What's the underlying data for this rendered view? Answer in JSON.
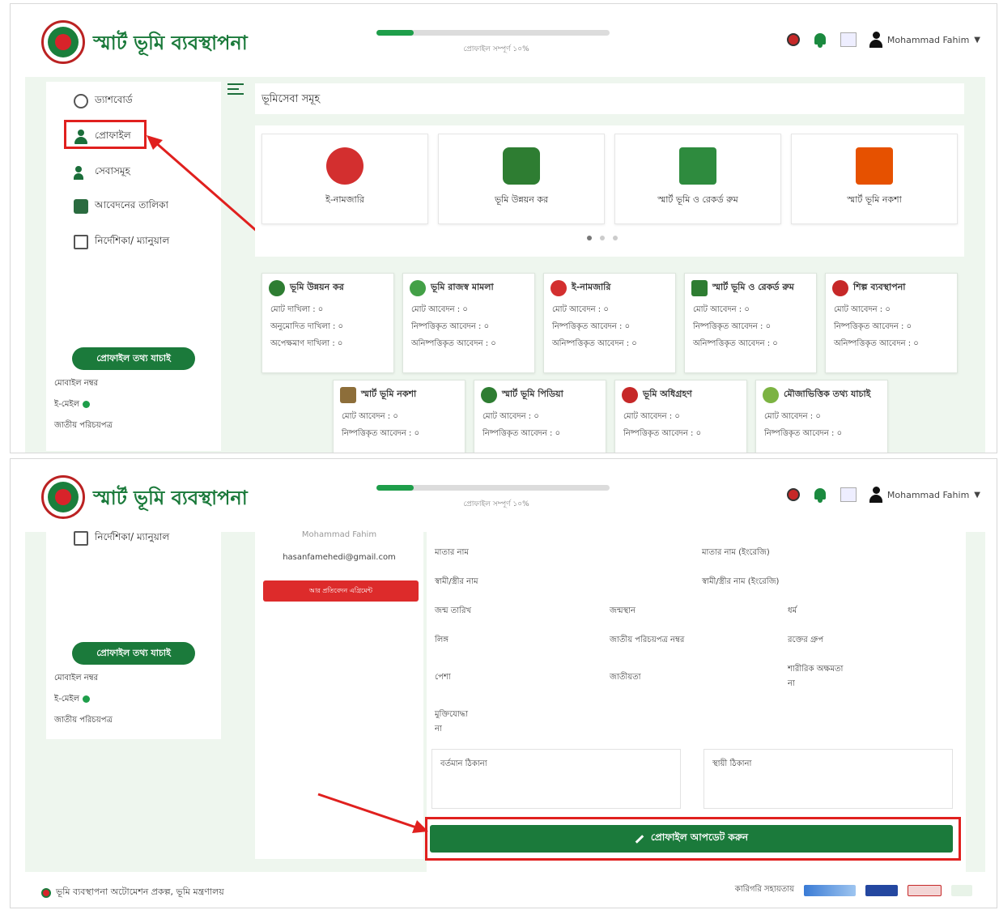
{
  "header": {
    "app_title": "স্মার্ট ভূমি ব্যবস্থাপনা",
    "progress_label": "প্রোফাইল সম্পূর্ণ ১০%",
    "progress_percent": 10,
    "user_name": "Mohammad Fahim"
  },
  "sidebar": {
    "items": [
      {
        "label": "ড্যাশবোর্ড",
        "icon": "dashboard-icon"
      },
      {
        "label": "প্রোফাইল",
        "icon": "profile-icon"
      },
      {
        "label": "সেবাসমূহ",
        "icon": "services-icon"
      },
      {
        "label": "আবেদনের তালিকা",
        "icon": "application-list-icon"
      },
      {
        "label": "নির্দেশিকা/ ম্যানুয়াল",
        "icon": "guide-icon"
      }
    ],
    "profile_info_button": "প্রোফাইল তথ্য যাচাই",
    "info_lines": [
      "মোবাইল নম্বর",
      "ই-মেইল",
      "জাতীয় পরিচয়পত্র"
    ]
  },
  "main": {
    "page_title": "ভূমিসেবা সমূহ",
    "carousel_cards": [
      {
        "label": "ই-নামজারি",
        "color": "#d32f2f"
      },
      {
        "label": "ভূমি উন্নয়ন কর",
        "color": "#2e7d32"
      },
      {
        "label": "স্মার্ট ভূমি ও রেকর্ড রুম",
        "color": "#2e8b3e"
      },
      {
        "label": "স্মার্ট ভূমি নকশা",
        "color": "#e65100"
      }
    ],
    "tiles_row1": [
      {
        "title": "ভূমি উন্নয়ন কর",
        "rows": [
          "মোট দাখিলা : ০",
          "অনুমোদিত দাখিলা : ০",
          "অপেক্ষমাণ দাখিলা : ০"
        ],
        "color": "#2e7d32"
      },
      {
        "title": "ভূমি রাজস্ব মামলা",
        "rows": [
          "মোট আবেদন : ০",
          "নিষ্পত্তিকৃত আবেদন : ০",
          "অনিষ্পত্তিকৃত আবেদন : ০"
        ],
        "color": "#43a047"
      },
      {
        "title": "ই-নামজারি",
        "rows": [
          "মোট আবেদন : ০",
          "নিষ্পত্তিকৃত আবেদন : ০",
          "অনিষ্পত্তিকৃত আবেদন : ০"
        ],
        "color": "#d32f2f"
      },
      {
        "title": "স্মার্ট ভূমি ও রেকর্ড রুম",
        "rows": [
          "মোট আবেদন : ০",
          "নিষ্পত্তিকৃত আবেদন : ০",
          "অনিষ্পত্তিকৃত আবেদন : ০"
        ],
        "color": "#2e7d32"
      },
      {
        "title": "শিল্প ব্যবস্থাপনা",
        "rows": [
          "মোট আবেদন : ০",
          "নিষ্পত্তিকৃত আবেদন : ০",
          "অনিষ্পত্তিকৃত আবেদন : ০"
        ],
        "color": "#c62828"
      }
    ],
    "tiles_row2": [
      {
        "title": "স্মার্ট ভূমি নকশা",
        "rows": [
          "মোট আবেদন : ০",
          "নিষ্পত্তিকৃত আবেদন : ০"
        ],
        "color": "#8d6e3a"
      },
      {
        "title": "স্মার্ট ভূমি পিডিয়া",
        "rows": [
          "মোট আবেদন : ০",
          "নিষ্পত্তিকৃত আবেদন : ০"
        ],
        "color": "#2e7d32"
      },
      {
        "title": "ভূমি অধিগ্রহণ",
        "rows": [
          "মোট আবেদন : ০",
          "নিষ্পত্তিকৃত আবেদন : ০"
        ],
        "color": "#c62828"
      },
      {
        "title": "মৌজাভিত্তিক তথ্য যাচাই",
        "rows": [
          "মোট আবেদন : ০",
          "নিষ্পত্তিকৃত আবেদন : ০"
        ],
        "color": "#7cb342"
      }
    ]
  },
  "profile": {
    "name": "Mohammad Fahim",
    "email": "hasanfamehedi@gmail.com",
    "red_button": "আর প্রতিবেদন এগ্রিমেন্ট",
    "fields": {
      "mother_name": "মাতার নাম",
      "mother_name_en": "মাতার নাম (ইংরেজি)",
      "spouse_name": "স্বামী/স্ত্রীর নাম",
      "spouse_name_en": "স্বামী/স্ত্রীর নাম (ইংরেজি)",
      "dob": "জন্ম তারিখ",
      "birthplace": "জন্মস্থান",
      "religion": "ধর্ম",
      "gender": "লিঙ্গ",
      "nid_no": "জাতীয় পরিচয়পত্র নম্বর",
      "blood_group": "রক্তের গ্রুপ",
      "occupation": "পেশা",
      "nationality": "জাতীয়তা",
      "disability": "শারীরিক অক্ষমতা",
      "disability_value": "না",
      "freedom_fighter": "মুক্তিযোদ্ধা",
      "freedom_fighter_value": "না",
      "present_address": "বর্তমান ঠিকানা",
      "permanent_address": "স্থায়ী ঠিকানা"
    },
    "update_button": "প্রোফাইল আপডেট করুন"
  },
  "footer": {
    "left_text": "ভূমি ব্যবস্থাপনা অটোমেশন প্রকল্প, ভূমি মন্ত্রণালয়",
    "right_text": "কারিগরি সহায়তায়"
  },
  "colors": {
    "brand_green": "#1b7a3b",
    "highlight_red": "#e0201e",
    "page_bg": "#eef6ee"
  }
}
